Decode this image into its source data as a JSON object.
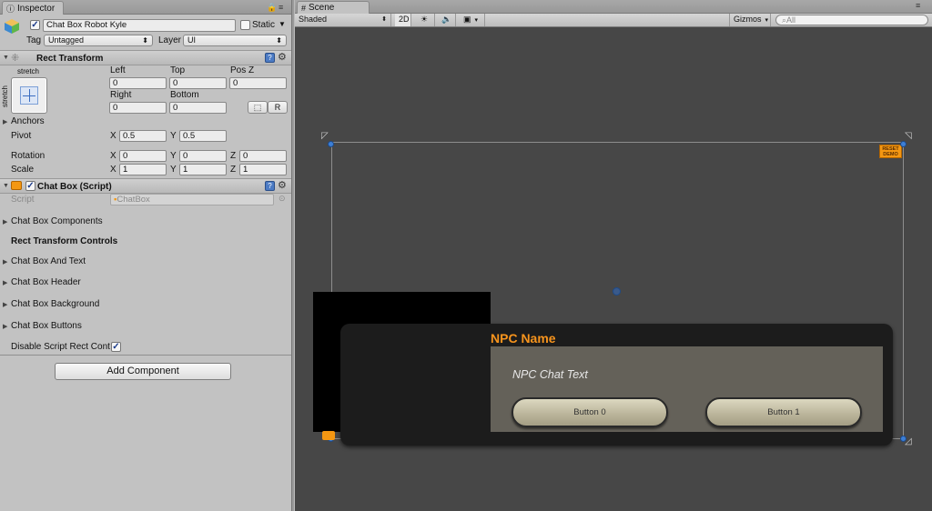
{
  "inspector": {
    "tab_label": "Inspector",
    "object_name": "Chat Box Robot Kyle",
    "static_label": "Static",
    "tag_label": "Tag",
    "tag_value": "Untagged",
    "layer_label": "Layer",
    "layer_value": "UI",
    "rect_transform": {
      "title": "Rect Transform",
      "anchor_preset_top": "stretch",
      "anchor_preset_side": "stretch",
      "left_label": "Left",
      "top_label": "Top",
      "posz_label": "Pos Z",
      "left": "0",
      "top": "0",
      "posz": "0",
      "right_label": "Right",
      "bottom_label": "Bottom",
      "right": "0",
      "bottom": "0",
      "raw_button": "R",
      "anchors_label": "Anchors",
      "pivot_label": "Pivot",
      "pivot_x": "0.5",
      "pivot_y": "0.5",
      "rotation_label": "Rotation",
      "rot_x": "0",
      "rot_y": "0",
      "rot_z": "0",
      "scale_label": "Scale",
      "scale_x": "1",
      "scale_y": "1",
      "scale_z": "1",
      "axis_x": "X",
      "axis_y": "Y",
      "axis_z": "Z"
    },
    "chat_box_script": {
      "title": "Chat Box (Script)",
      "script_label": "Script",
      "script_value": "ChatBox"
    },
    "sections": [
      "Chat Box Components",
      "Rect Transform Controls",
      "Chat Box And Text",
      "Chat Box Header",
      "Chat Box Background",
      "Chat Box Buttons"
    ],
    "disable_label": "Disable Script Rect Cont",
    "add_component": "Add Component"
  },
  "scene": {
    "tab_label": "Scene",
    "shading_mode": "Shaded",
    "mode_2d": "2D",
    "gizmos_label": "Gizmos",
    "search_placeholder": "All",
    "reset_badge": "RESET DEMO",
    "npc_name": "NPC Name",
    "npc_text": "NPC Chat Text",
    "button0": "Button 0",
    "button1": "Button 1"
  },
  "colors": {
    "npc_name": "#f7941d",
    "scene_bg": "#474747",
    "handle": "#3d7fd6",
    "badge": "#f49712"
  }
}
